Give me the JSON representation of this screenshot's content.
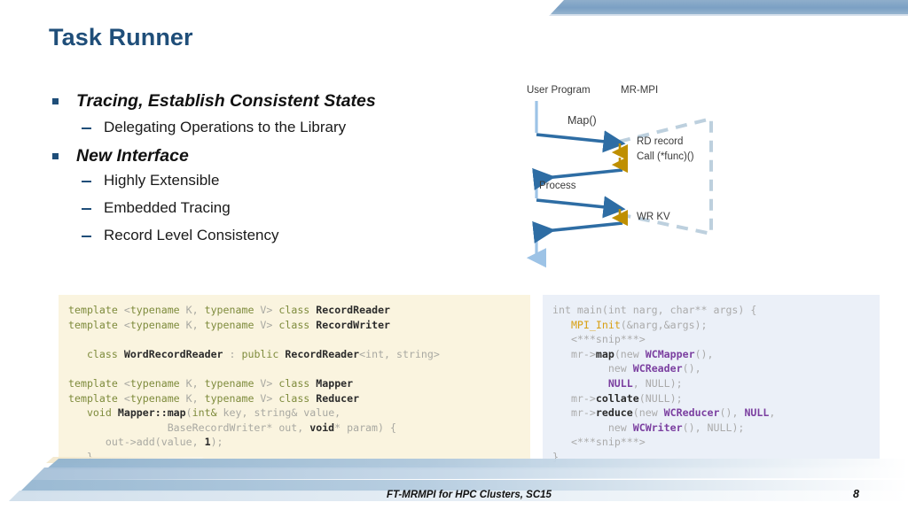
{
  "slide": {
    "title": "Task Runner",
    "number": "8",
    "footer": "FT-MRMPI for HPC Clusters, SC15"
  },
  "theme": {
    "title_color": "#1F4E79",
    "accent_bar": "#7BA0C4",
    "bullet_marker": "#1F4E79",
    "left_code_bg": "#FAF4DF",
    "right_code_bg": "#EBF0F8",
    "arrow_dark_blue": "#2E6DA4",
    "lifeline_light_blue": "#9DC3E6",
    "arrow_gold": "#BF8F00",
    "dashed_gray": "#BDD0DE"
  },
  "bullets": [
    {
      "level": 1,
      "text": "Tracing, Establish Consistent States"
    },
    {
      "level": 2,
      "text": "Delegating Operations to the Library"
    },
    {
      "level": 1,
      "text": "New Interface"
    },
    {
      "level": 2,
      "text": "Highly Extensible"
    },
    {
      "level": 2,
      "text": "Embedded Tracing"
    },
    {
      "level": 2,
      "text": "Record Level Consistency"
    }
  ],
  "diagram": {
    "type": "sequence",
    "lanes": [
      "User Program",
      "MR-MPI"
    ],
    "labels": {
      "user_program": "User Program",
      "mr_mpi": "MR-MPI",
      "map_call": "Map()",
      "rd_record": "RD record",
      "call_func": "Call (*func)()",
      "process": "Process",
      "wr_kv": "WR KV"
    }
  },
  "code_left": {
    "language": "cpp",
    "lines": [
      "template <typename K, typename V> class RecordReader",
      "template <typename K, typename V> class RecordWriter",
      "",
      "   class WordRecordReader : public RecordReader<int, string>",
      "",
      "template <typename K, typename V> class Mapper",
      "template <typename K, typename V> class Reducer",
      "   void Mapper::map(int& key, string& value,",
      "                 BaseRecordWriter* out, void* param) {",
      "      out->add(value, 1);",
      "   }"
    ]
  },
  "code_right": {
    "language": "cpp",
    "lines": [
      "int main(int narg, char** args) {",
      "   MPI_Init(&narg,&args);",
      "   <***snip***>",
      "   mr->map(new WCMapper(),",
      "           new WCReader(),",
      "           NULL, NULL);",
      "   mr->collate(NULL);",
      "   mr->reduce(new WCReducer(), NULL,",
      "           new WCWriter(), NULL);",
      "   <***snip***>",
      "}"
    ]
  }
}
